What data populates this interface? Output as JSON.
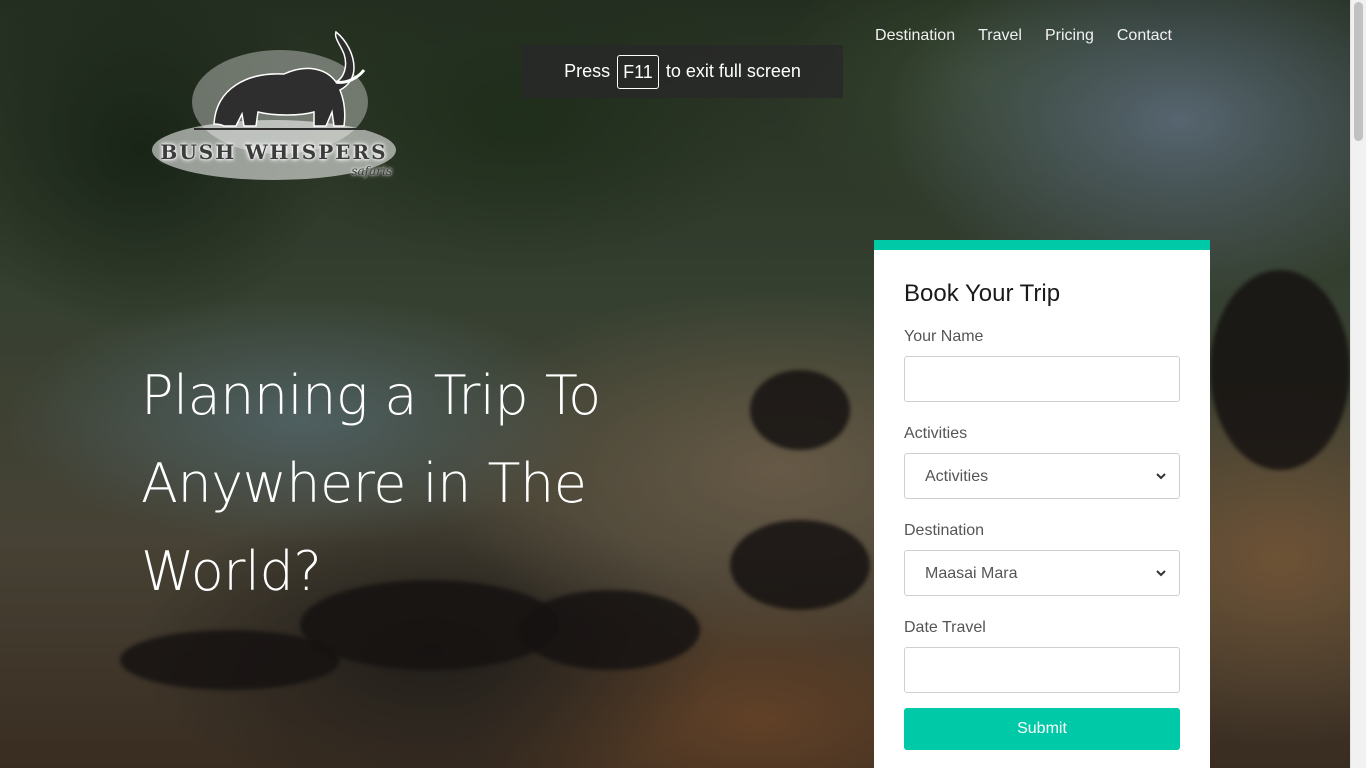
{
  "logo": {
    "brand": "Bush Whispers",
    "sub": "safaris"
  },
  "nav": {
    "items": [
      {
        "label": "Destination"
      },
      {
        "label": "Travel"
      },
      {
        "label": "Pricing"
      },
      {
        "label": "Contact"
      }
    ]
  },
  "fullscreen_toast": {
    "press": "Press",
    "key": "F11",
    "rest": "to exit full screen"
  },
  "hero": {
    "headline": "Planning a Trip To Anywhere in The World?"
  },
  "booking": {
    "title": "Book Your Trip",
    "name_label": "Your Name",
    "name_value": "",
    "activities_label": "Activities",
    "activities_selected": "Activities",
    "destination_label": "Destination",
    "destination_selected": "Maasai Mara",
    "date_label": "Date Travel",
    "date_value": "",
    "submit_label": "Submit"
  },
  "colors": {
    "accent": "#00c9a7",
    "card_background": "#ffffff",
    "nav_text": "#f1f1f1"
  },
  "icons": {
    "logo": "elephant-icon",
    "select_caret": "chevron-down-icon"
  }
}
